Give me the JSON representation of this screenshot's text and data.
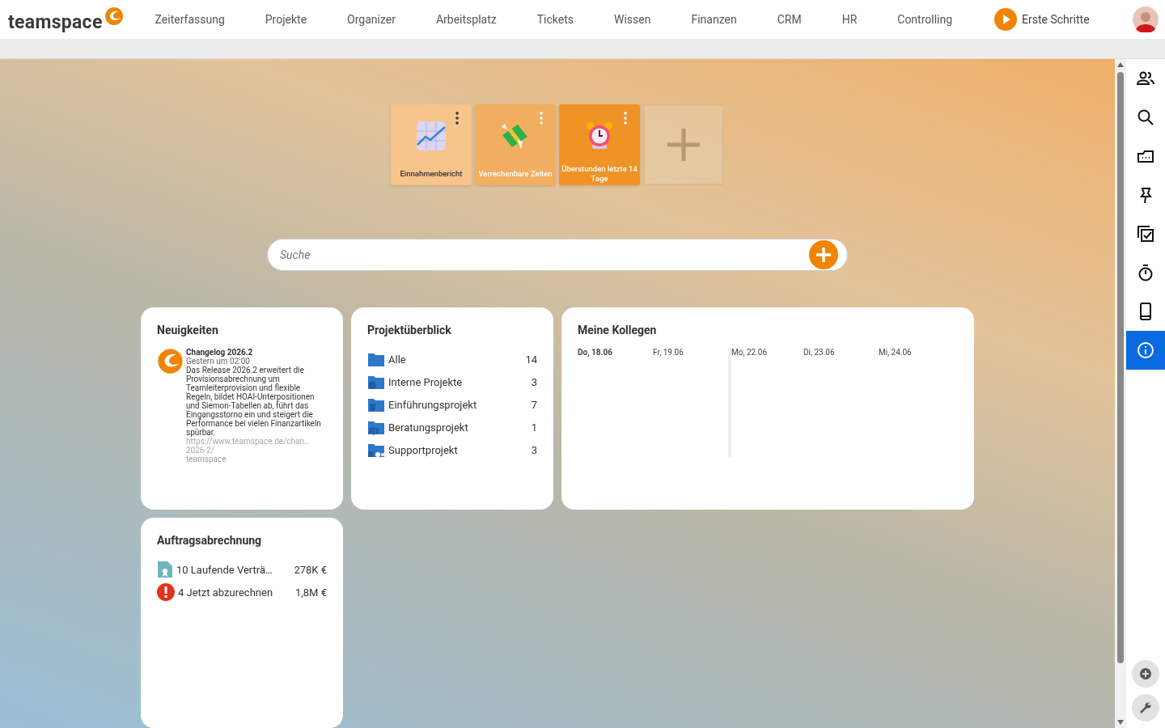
{
  "brand": "teamspace",
  "nav": [
    "Zeiterfassung",
    "Projekte",
    "Organizer",
    "Arbeitsplatz",
    "Tickets",
    "Wissen",
    "Finanzen",
    "CRM",
    "HR",
    "Controlling"
  ],
  "first_steps": "Erste Schritte",
  "tiles": [
    {
      "kind": "chart",
      "label": "Einnahmenbericht",
      "color": "#f7c48c"
    },
    {
      "kind": "money",
      "label": "Verrechenbare Zeiten",
      "color": "#f2ae60"
    },
    {
      "kind": "alarm",
      "label": "Überstunden letzte 14 Tage",
      "color": "#ef9327"
    }
  ],
  "search": {
    "placeholder": "Suche"
  },
  "news": {
    "title": "Neuigkeiten",
    "item": {
      "heading": "Changelog 2026.2",
      "time": "Gestern um 02:00",
      "body": "Das Release 2026.2 erweitert die Provisionsabrechnung um Teamleiterprovision und flexible Regeln, bildet HOAI-Unterpositionen und Siemon-Tabellen ab, führt das Eingangsstorno ein und steigert die Performance bei vielen Finanzartikeln spürbar.",
      "link": "https://www.teamspace.de/chan…",
      "link_rest": "2026-2/",
      "source": "teamspace"
    }
  },
  "projects": {
    "title": "Projektüberblick",
    "items": [
      {
        "kind": "all",
        "label": "Alle",
        "count": "14"
      },
      {
        "kind": "internal",
        "label": "Interne Projekte",
        "count": "3"
      },
      {
        "kind": "intro",
        "label": "Einführungsprojekt",
        "count": "7"
      },
      {
        "kind": "consult",
        "label": "Beratungsprojekt",
        "count": "1"
      },
      {
        "kind": "support",
        "label": "Supportprojekt",
        "count": "3"
      }
    ]
  },
  "colleagues": {
    "title": "Meine Kollegen",
    "days": [
      {
        "label": "Do, 18.06",
        "today": true,
        "week_start": false
      },
      {
        "label": "Fr, 19.06",
        "today": false,
        "week_start": false
      },
      {
        "label": "Mo, 22.06",
        "today": false,
        "week_start": true
      },
      {
        "label": "Di, 23.06",
        "today": false,
        "week_start": false
      },
      {
        "label": "Mi, 24.06",
        "today": false,
        "week_start": false
      }
    ]
  },
  "billing": {
    "title": "Auftragsabrechnung",
    "items": [
      {
        "kind": "contract",
        "label": "10 Laufende Verträ…",
        "amount": "278K €"
      },
      {
        "kind": "alert",
        "label": "4 Jetzt abzurechnen",
        "amount": "1,8M €"
      }
    ]
  },
  "sidebar": [
    {
      "kind": "people",
      "selected": false
    },
    {
      "kind": "search",
      "selected": false
    },
    {
      "kind": "inbox",
      "selected": false
    },
    {
      "kind": "pin",
      "selected": false
    },
    {
      "kind": "tasks",
      "selected": false
    },
    {
      "kind": "timer",
      "selected": false
    },
    {
      "kind": "phone",
      "selected": false
    },
    {
      "kind": "info",
      "selected": true
    }
  ]
}
